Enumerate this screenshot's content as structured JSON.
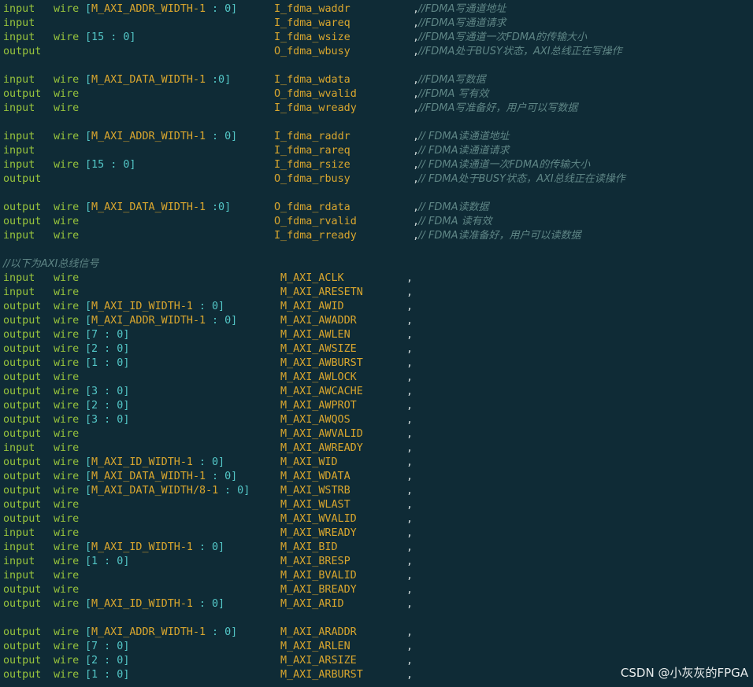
{
  "editor": {
    "lines": [
      {
        "d": "input",
        "t": "wire",
        "p": "[",
        "w": "M_AXI_ADDR_WIDTH-1",
        "r": " : 0]",
        "s": "I_fdma_waddr",
        "c": "//FDMA写通道地址"
      },
      {
        "d": "input",
        "t": "",
        "p": "",
        "w": "",
        "r": "",
        "s": "I_fdma_wareq",
        "c": "//FDMA写通道请求"
      },
      {
        "d": "input",
        "t": "wire",
        "p": "",
        "w": "",
        "r": "[15 : 0]",
        "s": "I_fdma_wsize",
        "c": "//FDMA写通道一次FDMA的传输大小"
      },
      {
        "d": "output",
        "t": "",
        "p": "",
        "w": "",
        "r": "",
        "s": "O_fdma_wbusy",
        "c": "//FDMA处于BUSY状态，AXI总线正在写操作"
      },
      {
        "blank": true
      },
      {
        "d": "input",
        "t": "wire",
        "p": "[",
        "w": "M_AXI_DATA_WIDTH-1",
        "r": " :0]",
        "s": "I_fdma_wdata",
        "c": "//FDMA写数据"
      },
      {
        "d": "output",
        "t": "wire",
        "p": "",
        "w": "",
        "r": "",
        "s": "O_fdma_wvalid",
        "c": "//FDMA 写有效"
      },
      {
        "d": "input",
        "t": "wire",
        "p": "",
        "w": "",
        "r": "",
        "s": "I_fdma_wready",
        "c": "//FDMA写准备好，用户可以写数据"
      },
      {
        "blank": true
      },
      {
        "d": "input",
        "t": "wire",
        "p": "[",
        "w": "M_AXI_ADDR_WIDTH-1",
        "r": " : 0]",
        "s": "I_fdma_raddr",
        "c": "// FDMA读通道地址"
      },
      {
        "d": "input",
        "t": "",
        "p": "",
        "w": "",
        "r": "",
        "s": "I_fdma_rareq",
        "c": "// FDMA读通道请求"
      },
      {
        "d": "input",
        "t": "wire",
        "p": "",
        "w": "",
        "r": "[15 : 0]",
        "s": "I_fdma_rsize",
        "c": "// FDMA读通道一次FDMA的传输大小"
      },
      {
        "d": "output",
        "t": "",
        "p": "",
        "w": "",
        "r": "",
        "s": "O_fdma_rbusy",
        "c": "// FDMA处于BUSY状态，AXI总线正在读操作"
      },
      {
        "blank": true
      },
      {
        "d": "output",
        "t": "wire",
        "p": "[",
        "w": "M_AXI_DATA_WIDTH-1",
        "r": " :0]",
        "s": "O_fdma_rdata",
        "c": "// FDMA读数据"
      },
      {
        "d": "output",
        "t": "wire",
        "p": "",
        "w": "",
        "r": "",
        "s": "O_fdma_rvalid",
        "c": "// FDMA 读有效"
      },
      {
        "d": "input",
        "t": "wire",
        "p": "",
        "w": "",
        "r": "",
        "s": "I_fdma_rready",
        "c": "// FDMA读准备好，用户可以读数据"
      },
      {
        "blank": true
      },
      {
        "full_comment": "//以下为AXI总线信号"
      },
      {
        "d": "input",
        "t": "wire",
        "p": "",
        "w": "",
        "r": "",
        "s": "M_AXI_ACLK",
        "c": ""
      },
      {
        "d": "input",
        "t": "wire",
        "p": "",
        "w": "",
        "r": "",
        "s": "M_AXI_ARESETN",
        "c": ""
      },
      {
        "d": "output",
        "t": "wire",
        "p": "[",
        "w": "M_AXI_ID_WIDTH-1",
        "r": " : 0]",
        "s": "M_AXI_AWID",
        "c": ""
      },
      {
        "d": "output",
        "t": "wire",
        "p": "[",
        "w": "M_AXI_ADDR_WIDTH-1",
        "r": " : 0]",
        "s": "M_AXI_AWADDR",
        "c": ""
      },
      {
        "d": "output",
        "t": "wire",
        "p": "",
        "w": "",
        "r": "[7 : 0]",
        "s": "M_AXI_AWLEN",
        "c": ""
      },
      {
        "d": "output",
        "t": "wire",
        "p": "",
        "w": "",
        "r": "[2 : 0]",
        "s": "M_AXI_AWSIZE",
        "c": ""
      },
      {
        "d": "output",
        "t": "wire",
        "p": "",
        "w": "",
        "r": "[1 : 0]",
        "s": "M_AXI_AWBURST",
        "c": ""
      },
      {
        "d": "output",
        "t": "wire",
        "p": "",
        "w": "",
        "r": "",
        "s": "M_AXI_AWLOCK",
        "c": ""
      },
      {
        "d": "output",
        "t": "wire",
        "p": "",
        "w": "",
        "r": "[3 : 0]",
        "s": "M_AXI_AWCACHE",
        "c": ""
      },
      {
        "d": "output",
        "t": "wire",
        "p": "",
        "w": "",
        "r": "[2 : 0]",
        "s": "M_AXI_AWPROT",
        "c": ""
      },
      {
        "d": "output",
        "t": "wire",
        "p": "",
        "w": "",
        "r": "[3 : 0]",
        "s": "M_AXI_AWQOS",
        "c": ""
      },
      {
        "d": "output",
        "t": "wire",
        "p": "",
        "w": "",
        "r": "",
        "s": "M_AXI_AWVALID",
        "c": ""
      },
      {
        "d": "input",
        "t": "wire",
        "p": "",
        "w": "",
        "r": "",
        "s": "M_AXI_AWREADY",
        "c": ""
      },
      {
        "d": "output",
        "t": "wire",
        "p": "[",
        "w": "M_AXI_ID_WIDTH-1",
        "r": " : 0]",
        "s": "M_AXI_WID",
        "c": ""
      },
      {
        "d": "output",
        "t": "wire",
        "p": "[",
        "w": "M_AXI_DATA_WIDTH-1",
        "r": " : 0]",
        "s": "M_AXI_WDATA",
        "c": ""
      },
      {
        "d": "output",
        "t": "wire",
        "p": "[",
        "w": "M_AXI_DATA_WIDTH/8-1",
        "r": " : 0]",
        "s": "M_AXI_WSTRB",
        "c": ""
      },
      {
        "d": "output",
        "t": "wire",
        "p": "",
        "w": "",
        "r": "",
        "s": "M_AXI_WLAST",
        "c": ""
      },
      {
        "d": "output",
        "t": "wire",
        "p": "",
        "w": "",
        "r": "",
        "s": "M_AXI_WVALID",
        "c": ""
      },
      {
        "d": "input",
        "t": "wire",
        "p": "",
        "w": "",
        "r": "",
        "s": "M_AXI_WREADY",
        "c": ""
      },
      {
        "d": "input",
        "t": "wire",
        "p": "[",
        "w": "M_AXI_ID_WIDTH-1",
        "r": " : 0]",
        "s": "M_AXI_BID",
        "c": ""
      },
      {
        "d": "input",
        "t": "wire",
        "p": "",
        "w": "",
        "r": "[1 : 0]",
        "s": "M_AXI_BRESP",
        "c": ""
      },
      {
        "d": "input",
        "t": "wire",
        "p": "",
        "w": "",
        "r": "",
        "s": "M_AXI_BVALID",
        "c": ""
      },
      {
        "d": "output",
        "t": "wire",
        "p": "",
        "w": "",
        "r": "",
        "s": "M_AXI_BREADY",
        "c": ""
      },
      {
        "d": "output",
        "t": "wire",
        "p": "[",
        "w": "M_AXI_ID_WIDTH-1",
        "r": " : 0]",
        "s": "M_AXI_ARID",
        "c": ""
      },
      {
        "blank": true
      },
      {
        "d": "output",
        "t": "wire",
        "p": "[",
        "w": "M_AXI_ADDR_WIDTH-1",
        "r": " : 0]",
        "s": "M_AXI_ARADDR",
        "c": ""
      },
      {
        "d": "output",
        "t": "wire",
        "p": "",
        "w": "",
        "r": "[7 : 0]",
        "s": "M_AXI_ARLEN",
        "c": ""
      },
      {
        "d": "output",
        "t": "wire",
        "p": "",
        "w": "",
        "r": "[2 : 0]",
        "s": "M_AXI_ARSIZE",
        "c": ""
      },
      {
        "d": "output",
        "t": "wire",
        "p": "",
        "w": "",
        "r": "[1 : 0]",
        "s": "M_AXI_ARBURST",
        "c": ""
      }
    ]
  },
  "watermark": "CSDN @小灰灰的FPGA",
  "colors": {
    "background": "#0f2b36",
    "keyword": "#98c43c",
    "signal": "#d9a62e",
    "bracket": "#54c8c8",
    "comment": "#5f8686"
  }
}
